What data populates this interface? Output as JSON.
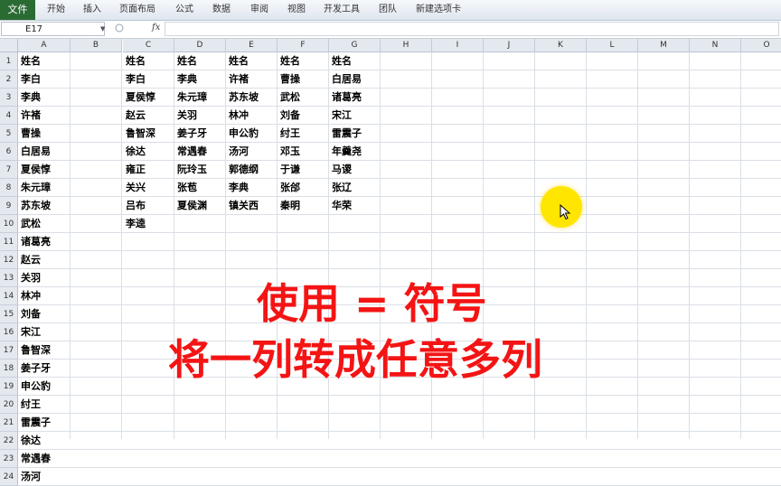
{
  "ribbon": {
    "file_tab": "文件",
    "tabs": [
      "开始",
      "插入",
      "页面布局",
      "公式",
      "数据",
      "审阅",
      "视图",
      "开发工具",
      "团队",
      "新建选项卡"
    ]
  },
  "formula_bar": {
    "name_box": "E17",
    "fx": "fx",
    "formula": ""
  },
  "columns": [
    "A",
    "B",
    "C",
    "D",
    "E",
    "F",
    "G",
    "H",
    "I",
    "J",
    "K",
    "L",
    "M",
    "N",
    "O"
  ],
  "rows": [
    "1",
    "2",
    "3",
    "4",
    "5",
    "6",
    "7",
    "8",
    "9",
    "10",
    "11",
    "12",
    "13",
    "14",
    "15",
    "16",
    "17",
    "18",
    "19",
    "20",
    "21",
    "22",
    "23",
    "24"
  ],
  "sheet": {
    "col_a": [
      "姓名",
      "李白",
      "李典",
      "许褚",
      "曹操",
      "白居易",
      "夏侯惇",
      "朱元璋",
      "苏东坡",
      "武松",
      "诸葛亮",
      "赵云",
      "关羽",
      "林冲",
      "刘备",
      "宋江",
      "鲁智深",
      "姜子牙",
      "申公豹",
      "纣王",
      "雷震子",
      "徐达",
      "常遇春",
      "汤河"
    ],
    "col_c": [
      "姓名",
      "李白",
      "夏侯惇",
      "赵云",
      "鲁智深",
      "徐达",
      "雍正",
      "关兴",
      "吕布",
      "李逵"
    ],
    "col_d": [
      "姓名",
      "李典",
      "朱元璋",
      "关羽",
      "姜子牙",
      "常遇春",
      "阮玲玉",
      "张苞",
      "夏侯渊"
    ],
    "col_e": [
      "姓名",
      "许褚",
      "苏东坡",
      "林冲",
      "申公豹",
      "汤河",
      "郭德纲",
      "李典",
      "镇关西"
    ],
    "col_f": [
      "姓名",
      "曹操",
      "武松",
      "刘备",
      "纣王",
      "邓玉",
      "于谦",
      "张郃",
      "秦明"
    ],
    "col_g": [
      "姓名",
      "白居易",
      "诸葛亮",
      "宋江",
      "雷震子",
      "年羹尧",
      "马谡",
      "张辽",
      "华荣"
    ]
  },
  "overlay": {
    "line1": "使用 = 符号",
    "line2": "将一列转成任意多列",
    "color": "#f41414"
  },
  "cursor": {
    "highlight_color": "#ffe600"
  }
}
